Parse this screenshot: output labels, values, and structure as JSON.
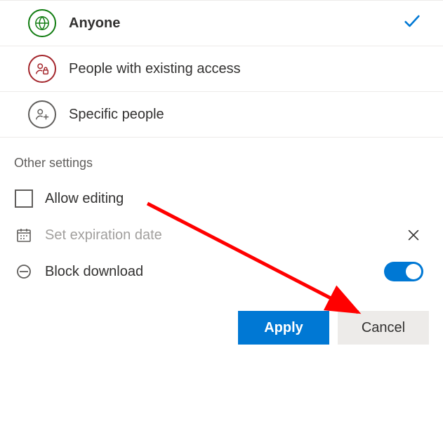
{
  "share_options": {
    "anyone": {
      "label": "Anyone",
      "selected": true
    },
    "existing": {
      "label": "People with existing access",
      "selected": false
    },
    "specific": {
      "label": "Specific people",
      "selected": false
    }
  },
  "section_title": "Other settings",
  "settings": {
    "allow_editing": {
      "label": "Allow editing",
      "checked": false
    },
    "expiration": {
      "label": "Set expiration date"
    },
    "block_download": {
      "label": "Block download",
      "on": true
    }
  },
  "buttons": {
    "apply": "Apply",
    "cancel": "Cancel"
  },
  "colors": {
    "primary": "#0078d4",
    "green": "#107c10",
    "red": "#a4262c"
  }
}
